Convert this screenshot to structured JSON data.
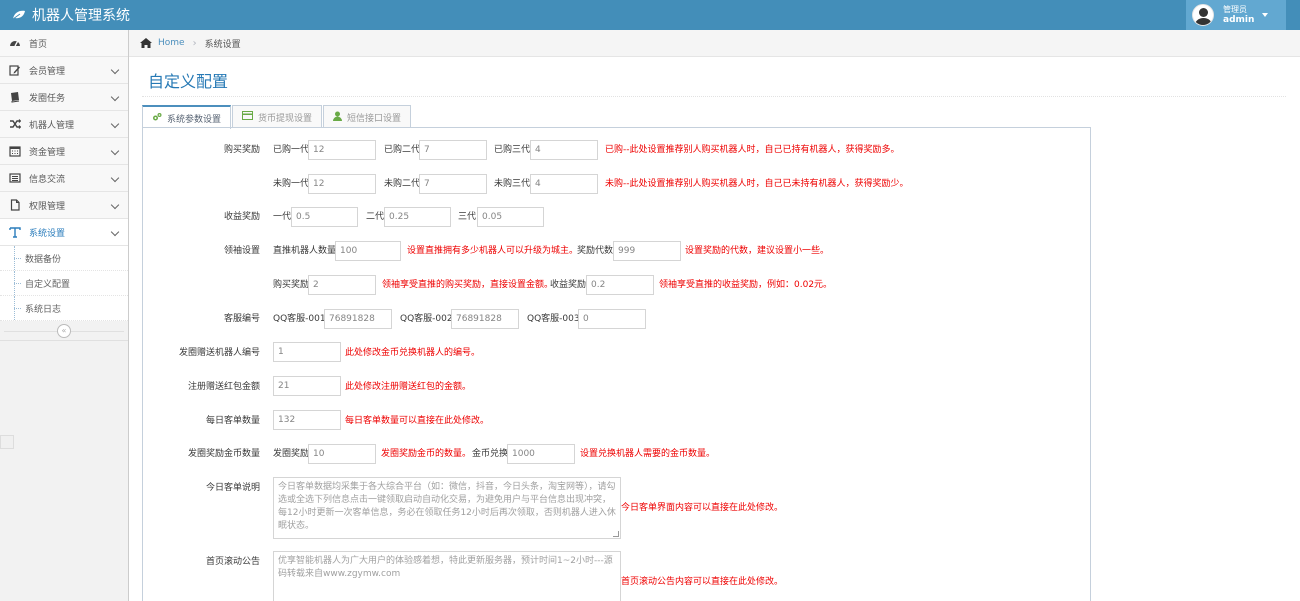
{
  "app": {
    "title": "机器人管理系统"
  },
  "user": {
    "role": "管理员",
    "name": "admin"
  },
  "sidebar": {
    "items": [
      {
        "label": "首页"
      },
      {
        "label": "会员管理"
      },
      {
        "label": "发圈任务"
      },
      {
        "label": "机器人管理"
      },
      {
        "label": "资金管理"
      },
      {
        "label": "信息交流"
      },
      {
        "label": "权限管理"
      },
      {
        "label": "系统设置"
      }
    ],
    "subitems": [
      {
        "label": "数据备份"
      },
      {
        "label": "自定义配置"
      },
      {
        "label": "系统日志"
      }
    ],
    "collapse_glyph": "«"
  },
  "breadcrumb": {
    "home": "Home",
    "current": "系统设置"
  },
  "page": {
    "title": "自定义配置"
  },
  "tabs": [
    {
      "label": "系统参数设置"
    },
    {
      "label": "货币提现设置"
    },
    {
      "label": "短信接口设置"
    }
  ],
  "form": {
    "buy_reward": {
      "label": "购买奖励",
      "bought": {
        "l1": "已购一代",
        "v1": "12",
        "l2": "已购二代",
        "v2": "7",
        "l3": "已购三代",
        "v3": "4",
        "hint": "已购--此处设置推荐别人购买机器人时，自己已持有机器人，获得奖励多。"
      },
      "unbought": {
        "l1": "未购一代",
        "v1": "12",
        "l2": "未购二代",
        "v2": "7",
        "l3": "未购三代",
        "v3": "4",
        "hint": "未购--此处设置推荐别人购买机器人时，自己已未持有机器人，获得奖励少。"
      }
    },
    "income_reward": {
      "label": "收益奖励",
      "l1": "一代",
      "v1": "0.5",
      "l2": "二代",
      "v2": "0.25",
      "l3": "三代",
      "v3": "0.05"
    },
    "leader": {
      "label": "领袖设置",
      "robots_label": "直推机器人数量",
      "robots_value": "100",
      "robots_hint": "设置直推拥有多少机器人可以升级为城主。",
      "levels_label": "奖励代数",
      "levels_value": "999",
      "levels_hint": "设置奖励的代数，建议设置小一些。",
      "buy_label": "购买奖励",
      "buy_value": "2",
      "buy_hint": "领袖享受直推的购买奖励，直接设置金额。",
      "income_label": "收益奖励",
      "income_value": "0.2",
      "income_hint": "领袖享受直推的收益奖励，例如：0.02元。"
    },
    "service": {
      "label": "客服编号",
      "l1": "QQ客服-001",
      "v1": "76891828",
      "l2": "QQ客服-002",
      "v2": "76891828",
      "l3": "QQ客服-003",
      "v3": "0"
    },
    "gift_robot": {
      "label": "发圈赠送机器人编号",
      "value": "1",
      "hint": "此处修改金币兑换机器人的编号。"
    },
    "register_bonus": {
      "label": "注册赠送红包金额",
      "value": "21",
      "hint": "此处修改注册赠送红包的金额。"
    },
    "daily_orders": {
      "label": "每日客单数量",
      "value": "132",
      "hint": "每日客单数量可以直接在此处修改。"
    },
    "coin_reward": {
      "label": "发圈奖励金币数量",
      "l1": "发圈奖励",
      "v1": "10",
      "hint1": "发圈奖励金币的数量。",
      "l2": "金币兑换",
      "v2": "1000",
      "hint2": "设置兑换机器人需要的金币数量。"
    },
    "daily_desc": {
      "label": "今日客单说明",
      "value": "今日客单数据均采集于各大综合平台（如：微信，抖音，今日头条，淘宝网等），请勾选或全选下列信息点击一键领取启动自动化交易，为避免用户与平台信息出现冲突，每12小时更新一次客单信息，务必在领取任务12小时后再次领取，否则机器人进入休眠状态。",
      "hint": "今日客单界面内容可以直接在此处修改。"
    },
    "scroll_notice": {
      "label": "首页滚动公告",
      "value": "优享智能机器人为广大用户的体验感着想，特此更新服务器，预计时间1~2小时---源码转载来自www.zgymw.com",
      "hint": "首页滚动公告内容可以直接在此处修改。"
    }
  }
}
